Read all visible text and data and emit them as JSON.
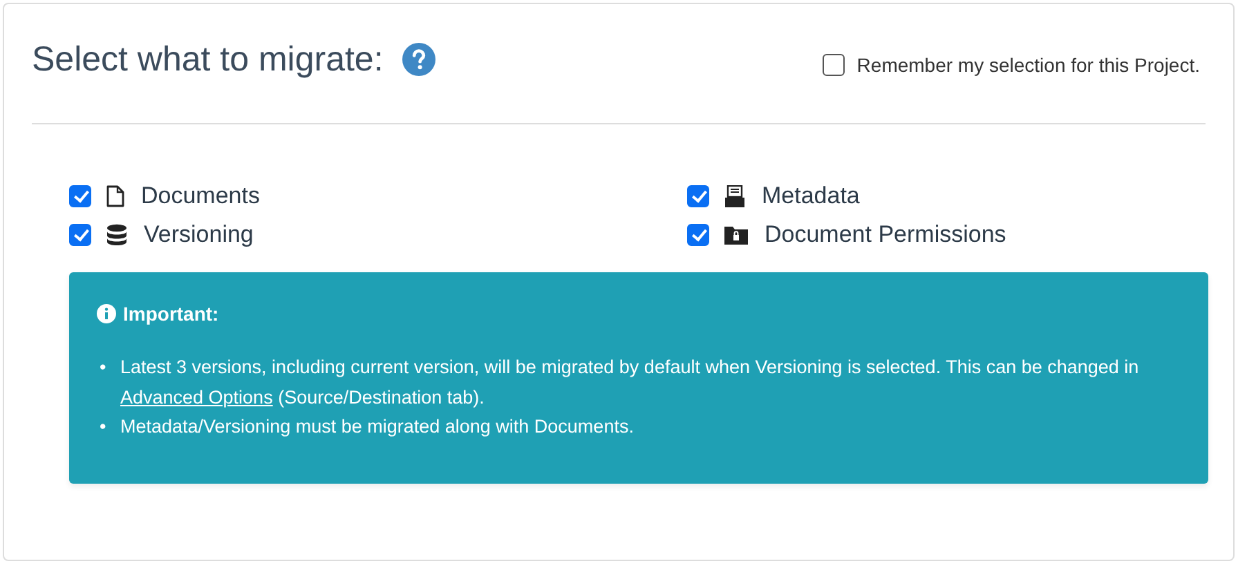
{
  "title": "Select what to migrate:",
  "remember": {
    "label": "Remember my selection for this Project.",
    "checked": false
  },
  "options": [
    {
      "label": "Documents",
      "kind": "document",
      "checked": true
    },
    {
      "label": "Metadata",
      "kind": "archive",
      "checked": true
    },
    {
      "label": "Versioning",
      "kind": "stack",
      "checked": true
    },
    {
      "label": "Document Permissions",
      "kind": "folder",
      "checked": true
    }
  ],
  "alert": {
    "heading": "Important:",
    "notes": [
      {
        "bullet": "•",
        "before": "Latest 3 versions, including current version, will be migrated by default when Versioning is selected. This can be changed in ",
        "link": "Advanced Options",
        "after": " (Source/Destination tab)."
      },
      {
        "bullet": "•",
        "before": "Metadata/Versioning must be migrated along with Documents."
      }
    ]
  }
}
